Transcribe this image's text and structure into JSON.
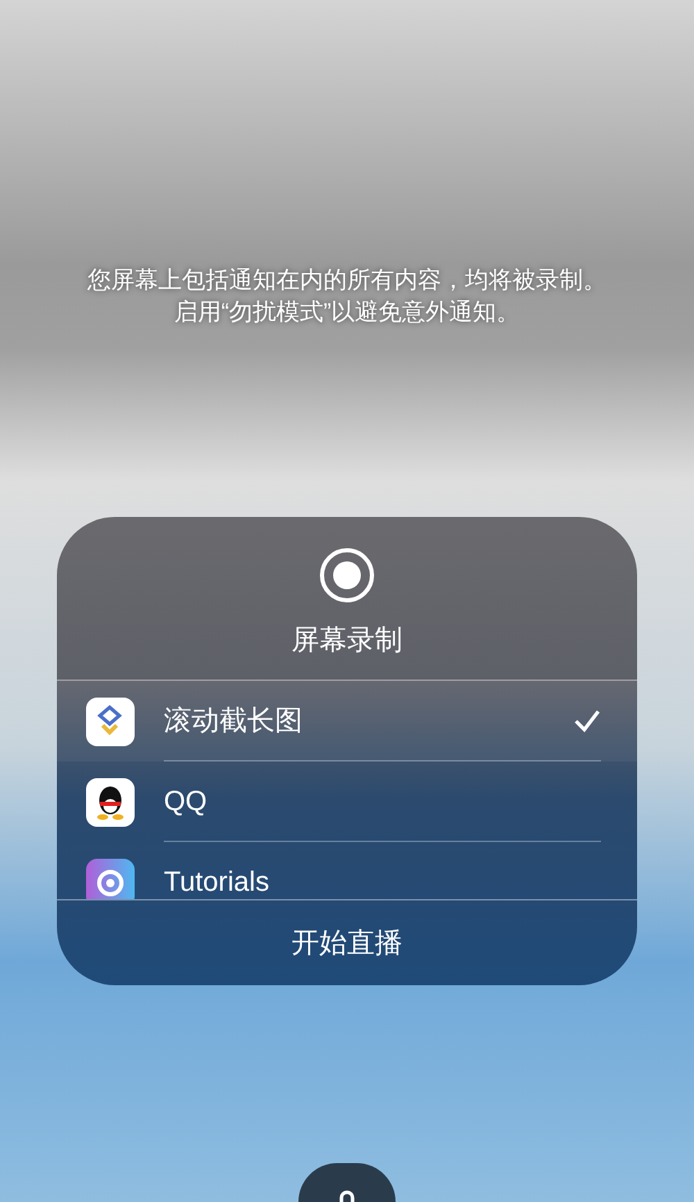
{
  "notice": "您屏幕上包括通知在内的所有内容，均将被录制。启用“勿扰模式”以避免意外通知。",
  "sheet": {
    "title": "屏幕录制",
    "apps": [
      {
        "name": "滚动截长图",
        "kind": "scroll",
        "selected": true
      },
      {
        "name": "QQ",
        "kind": "penguin",
        "selected": false
      },
      {
        "name": "Tutorials",
        "kind": "tutorials",
        "selected": false
      }
    ],
    "start_button": "开始直播"
  }
}
